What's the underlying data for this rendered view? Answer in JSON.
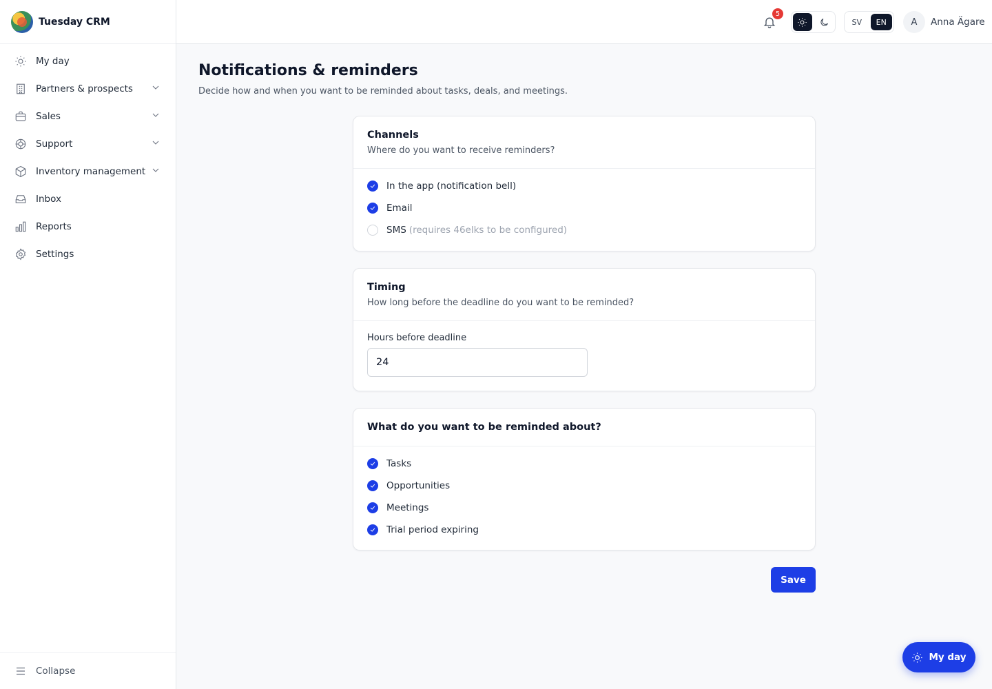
{
  "app": {
    "name": "Tuesday CRM"
  },
  "sidebar": {
    "items": [
      {
        "label": "My day",
        "icon": "sun-icon",
        "expandable": false
      },
      {
        "label": "Partners & prospects",
        "icon": "building-icon",
        "expandable": true
      },
      {
        "label": "Sales",
        "icon": "briefcase-icon",
        "expandable": true
      },
      {
        "label": "Support",
        "icon": "lifebuoy-icon",
        "expandable": true
      },
      {
        "label": "Inventory management",
        "icon": "box-icon",
        "expandable": true
      },
      {
        "label": "Inbox",
        "icon": "inbox-icon",
        "expandable": false
      },
      {
        "label": "Reports",
        "icon": "bar-chart-icon",
        "expandable": false
      },
      {
        "label": "Settings",
        "icon": "gear-icon",
        "expandable": false
      }
    ],
    "collapse_label": "Collapse"
  },
  "topbar": {
    "notification_count": "5",
    "theme_active": "light",
    "languages": [
      "SV",
      "EN"
    ],
    "language_active": "EN",
    "user_initial": "A",
    "user_name": "Anna Ägare"
  },
  "page": {
    "title": "Notifications & reminders",
    "subtitle": "Decide how and when you want to be reminded about tasks, deals, and meetings."
  },
  "channels": {
    "title": "Channels",
    "description": "Where do you want to receive reminders?",
    "options": [
      {
        "label": "In the app (notification bell)",
        "hint": "",
        "checked": true
      },
      {
        "label": "Email",
        "hint": "",
        "checked": true
      },
      {
        "label": "SMS",
        "hint": "(requires 46elks to be configured)",
        "checked": false
      }
    ]
  },
  "timing": {
    "title": "Timing",
    "description": "How long before the deadline do you want to be reminded?",
    "field_label": "Hours before deadline",
    "value": "24"
  },
  "reminders": {
    "title": "What do you want to be reminded about?",
    "options": [
      {
        "label": "Tasks",
        "checked": true
      },
      {
        "label": "Opportunities",
        "checked": true
      },
      {
        "label": "Meetings",
        "checked": true
      },
      {
        "label": "Trial period expiring",
        "checked": true
      }
    ]
  },
  "actions": {
    "save_label": "Save"
  },
  "fab": {
    "label": "My day"
  },
  "colors": {
    "primary": "#1d3ee6",
    "dark": "#0f172a",
    "badge": "#e53935"
  }
}
